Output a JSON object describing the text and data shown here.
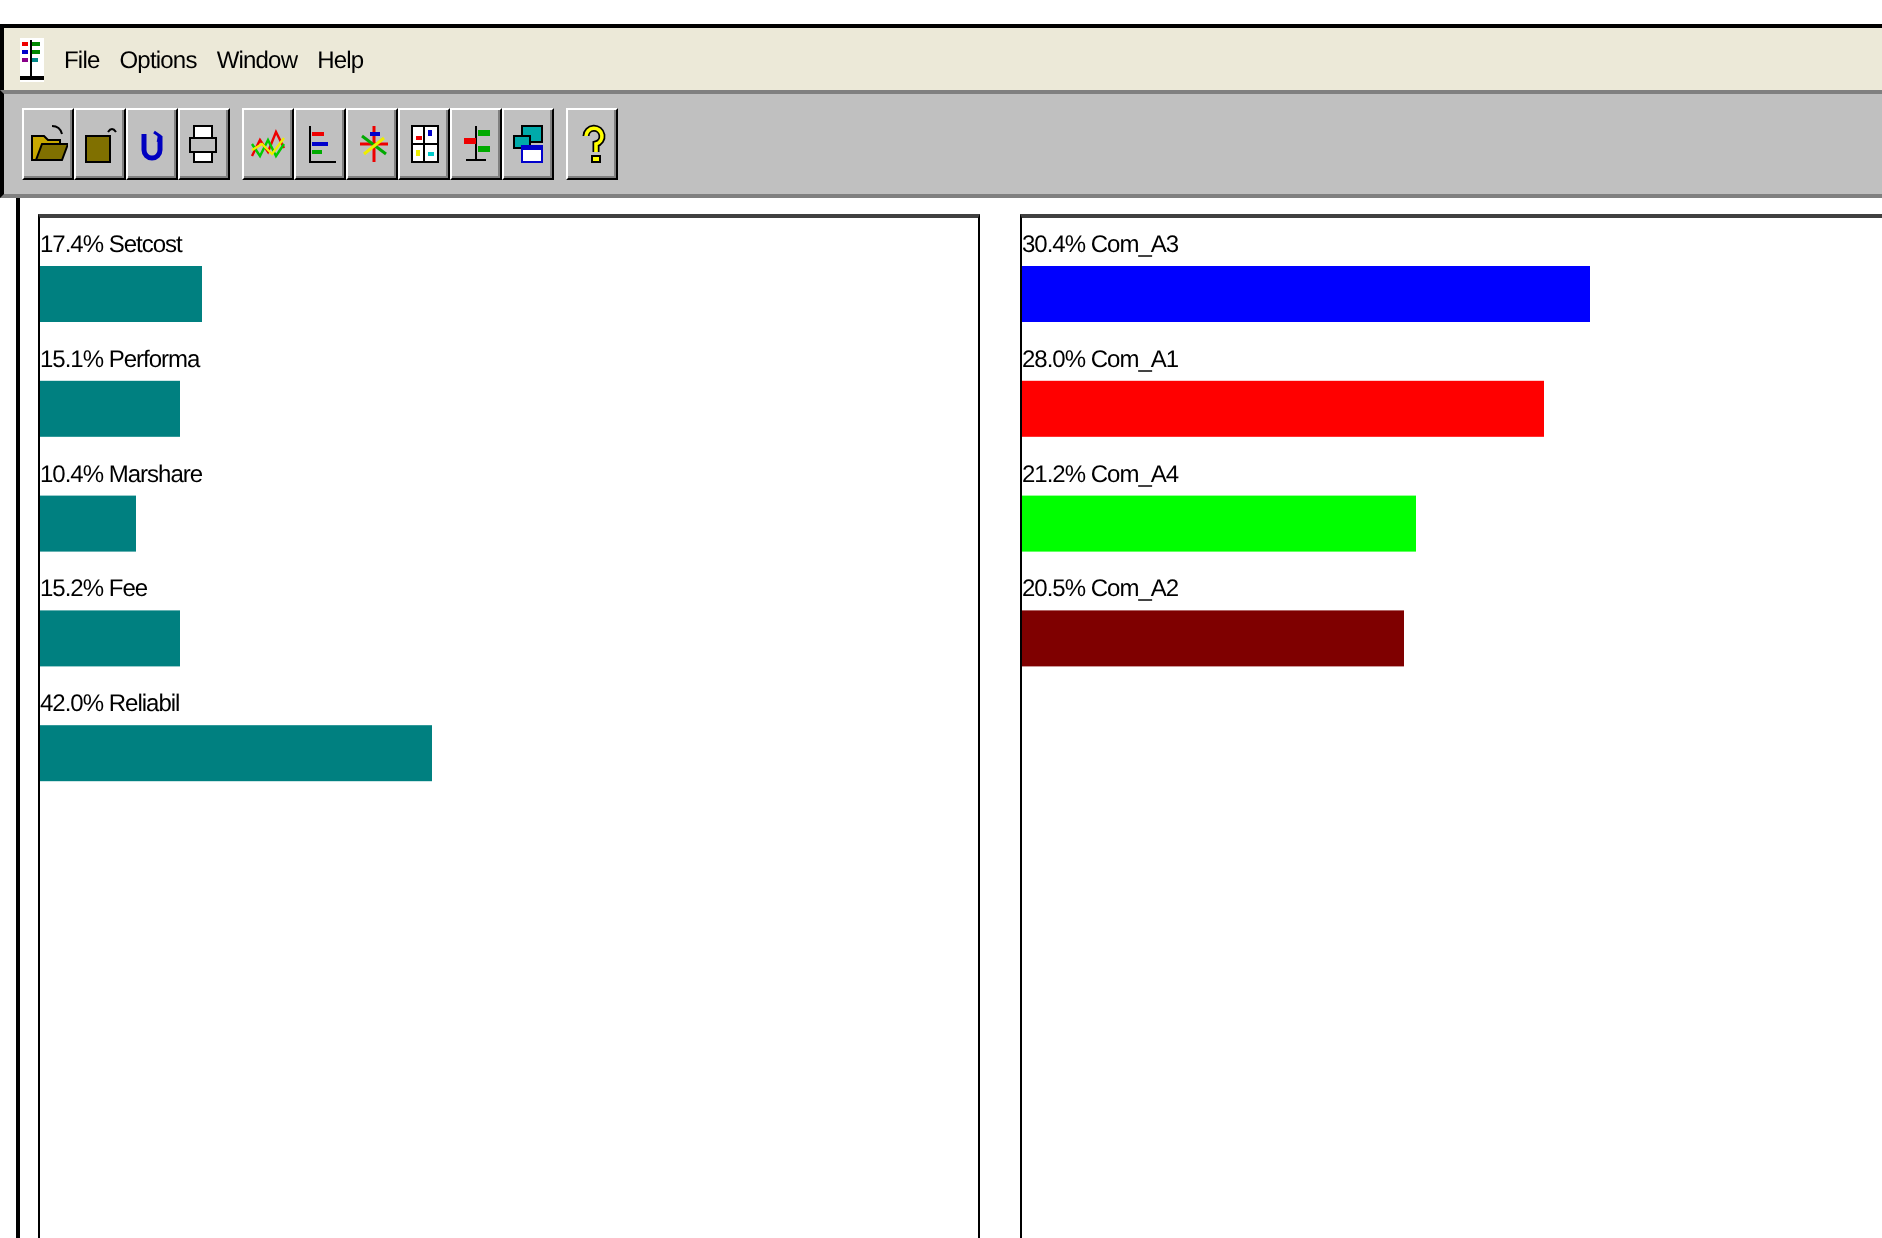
{
  "menu_bar": {
    "items": [
      "File",
      "Options",
      "Window",
      "Help"
    ]
  },
  "panels": [
    {
      "bars": [
        {
          "label": "17.4% Setcost"
        },
        {
          "label": "15.1% Performa"
        },
        {
          "label": "10.4% Marshare"
        },
        {
          "label": "15.2% Fee"
        },
        {
          "label": "42.0% Reliabil"
        }
      ]
    },
    {
      "bars": [
        {
          "label": "30.4% Com_A3",
          "color": "#0000ff"
        },
        {
          "label": "28.0% Com_A1",
          "color": "#ff0000"
        },
        {
          "label": "21.2% Com_A4",
          "color": "#00ff00"
        },
        {
          "label": "20.5% Com_A2",
          "color": "#7f0000"
        }
      ]
    }
  ]
}
